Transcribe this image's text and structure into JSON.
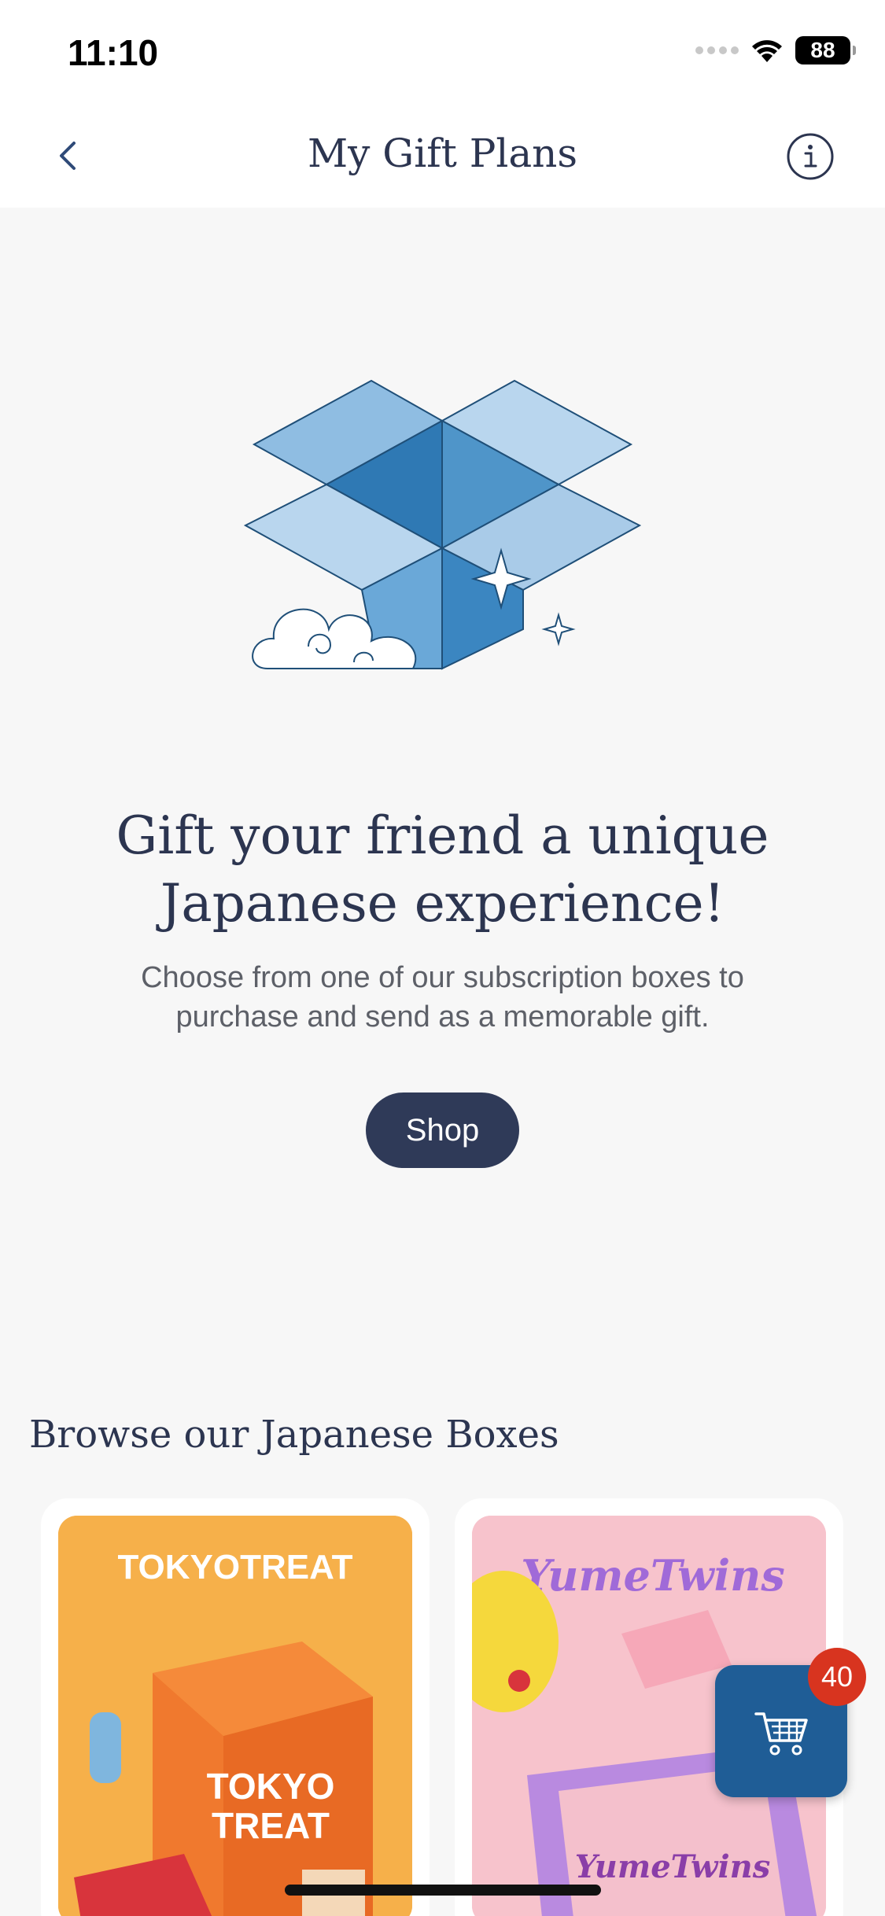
{
  "status_bar": {
    "time": "11:10",
    "battery": "88"
  },
  "nav": {
    "title": "My Gift Plans",
    "back_icon": "chevron-left-icon",
    "info_icon": "info-icon"
  },
  "hero": {
    "heading_line1": "Gift your friend a unique",
    "heading_line2": "Japanese experience!",
    "subtext_line1": "Choose from one of our subscription boxes to",
    "subtext_line2": "purchase and send as a memorable gift.",
    "shop_label": "Shop"
  },
  "browse": {
    "heading": "Browse our Japanese Boxes",
    "boxes": [
      {
        "brand": "TOKYOTREAT",
        "box_text_1": "TOKYO",
        "box_text_2": "TREAT",
        "color": "#f6b04a"
      },
      {
        "brand": "YumeTwins",
        "box_text": "YumeTwins",
        "color": "#f7c3cc"
      }
    ]
  },
  "cart": {
    "count": "40",
    "icon": "cart-icon"
  },
  "colors": {
    "accent": "#2f3a58",
    "cart_blue": "#1f5d96",
    "badge_red": "#d8341f"
  }
}
